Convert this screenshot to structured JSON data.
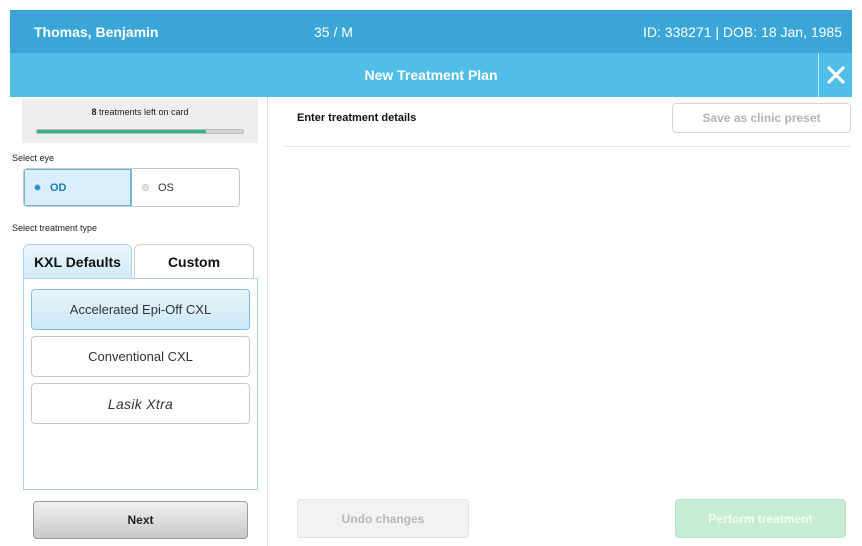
{
  "patient": {
    "name": "Thomas, Benjamin",
    "age_sex": "35 / M",
    "id_dob": "ID: 338271 | DOB: 18 Jan, 1985"
  },
  "title_bar": {
    "title": "New Treatment Plan",
    "close_icon": "close-icon"
  },
  "card": {
    "count": "8",
    "text": "treatments left on card",
    "progress_fraction": 0.82
  },
  "eye": {
    "label": "Select eye",
    "options": [
      "OD",
      "OS"
    ],
    "selected": "OD"
  },
  "treatment_type": {
    "label": "Select treatment type",
    "tabs": [
      "KXL Defaults",
      "Custom"
    ],
    "active_tab": "KXL Defaults",
    "options": [
      "Accelerated Epi-Off CXL",
      "Conventional CXL",
      "Lasik Xtra"
    ],
    "selected": "Accelerated Epi-Off CXL"
  },
  "buttons": {
    "next": "Next",
    "save_preset": "Save as clinic preset",
    "undo": "Undo changes",
    "perform": "Perform treatment"
  },
  "details": {
    "title": "Enter treatment details"
  },
  "colors": {
    "header": "#3aa6d7",
    "title_bar": "#50bee9",
    "progress": "#2fb58a",
    "perform_disabled": "#c6ecd5"
  }
}
